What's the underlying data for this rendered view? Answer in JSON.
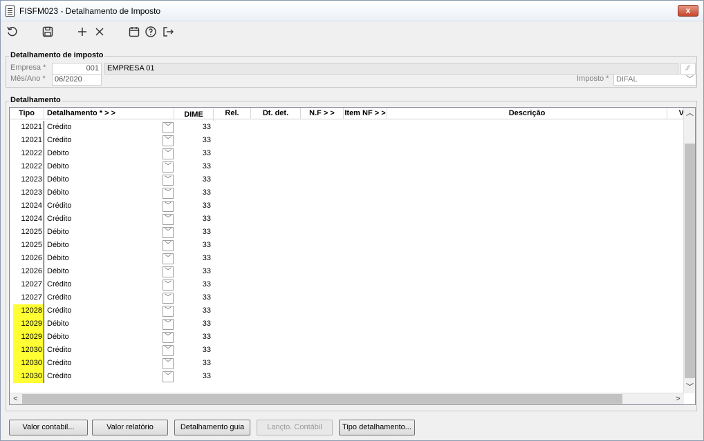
{
  "window": {
    "title": "FISFM023 - Detalhamento de Imposto",
    "close_label": "x"
  },
  "toolbar": {
    "icons": [
      "refresh-icon",
      "save-icon",
      "add-icon",
      "delete-icon",
      "calendar-icon",
      "help-icon",
      "exit-icon"
    ]
  },
  "header_group": {
    "legend": "Detalhamento de imposto",
    "empresa_label": "Empresa *",
    "empresa_code": "001",
    "empresa_name": "EMPRESA 01",
    "mes_ano_label": "Mês/Ano *",
    "mes_ano_value": "06/2020",
    "imposto_label": "Imposto *",
    "imposto_value": "DIFAL"
  },
  "detail_group": {
    "legend": "Detalhamento",
    "columns": {
      "tipo": "Tipo",
      "detalhamento": "Detalhamento *  > >",
      "dime": "DIME",
      "rel": "Rel.",
      "dt_det": "Dt. det.",
      "nf": "N.F  > >",
      "item_nf": "Item NF  > >",
      "descricao": "Descrição",
      "v": "V"
    },
    "rows": [
      {
        "tipo": "12021",
        "det": "Crédito",
        "dime": "33",
        "hl": false
      },
      {
        "tipo": "12021",
        "det": "Crédito",
        "dime": "33",
        "hl": false
      },
      {
        "tipo": "12022",
        "det": "Débito",
        "dime": "33",
        "hl": false
      },
      {
        "tipo": "12022",
        "det": "Débito",
        "dime": "33",
        "hl": false
      },
      {
        "tipo": "12023",
        "det": "Débito",
        "dime": "33",
        "hl": false
      },
      {
        "tipo": "12023",
        "det": "Débito",
        "dime": "33",
        "hl": false
      },
      {
        "tipo": "12024",
        "det": "Crédito",
        "dime": "33",
        "hl": false
      },
      {
        "tipo": "12024",
        "det": "Crédito",
        "dime": "33",
        "hl": false
      },
      {
        "tipo": "12025",
        "det": "Débito",
        "dime": "33",
        "hl": false
      },
      {
        "tipo": "12025",
        "det": "Débito",
        "dime": "33",
        "hl": false
      },
      {
        "tipo": "12026",
        "det": "Débito",
        "dime": "33",
        "hl": false
      },
      {
        "tipo": "12026",
        "det": "Débito",
        "dime": "33",
        "hl": false
      },
      {
        "tipo": "12027",
        "det": "Crédito",
        "dime": "33",
        "hl": false
      },
      {
        "tipo": "12027",
        "det": "Crédito",
        "dime": "33",
        "hl": false
      },
      {
        "tipo": "12028",
        "det": "Crédito",
        "dime": "33",
        "hl": true
      },
      {
        "tipo": "12029",
        "det": "Débito",
        "dime": "33",
        "hl": true
      },
      {
        "tipo": "12029",
        "det": "Débito",
        "dime": "33",
        "hl": true
      },
      {
        "tipo": "12030",
        "det": "Crédito",
        "dime": "33",
        "hl": true
      },
      {
        "tipo": "12030",
        "det": "Crédito",
        "dime": "33",
        "hl": true
      },
      {
        "tipo": "12030",
        "det": "Crédito",
        "dime": "33",
        "hl": true
      }
    ],
    "highlight_color": "#ffff33"
  },
  "buttons": {
    "valor_contabil": "Valor contabil...",
    "valor_relatorio": "Valor relatório",
    "detalhamento_guia": "Detalhamento guia",
    "lancto_contabil": "Lançto. Contábil",
    "tipo_detalhamento": "Tipo detalhamento..."
  }
}
